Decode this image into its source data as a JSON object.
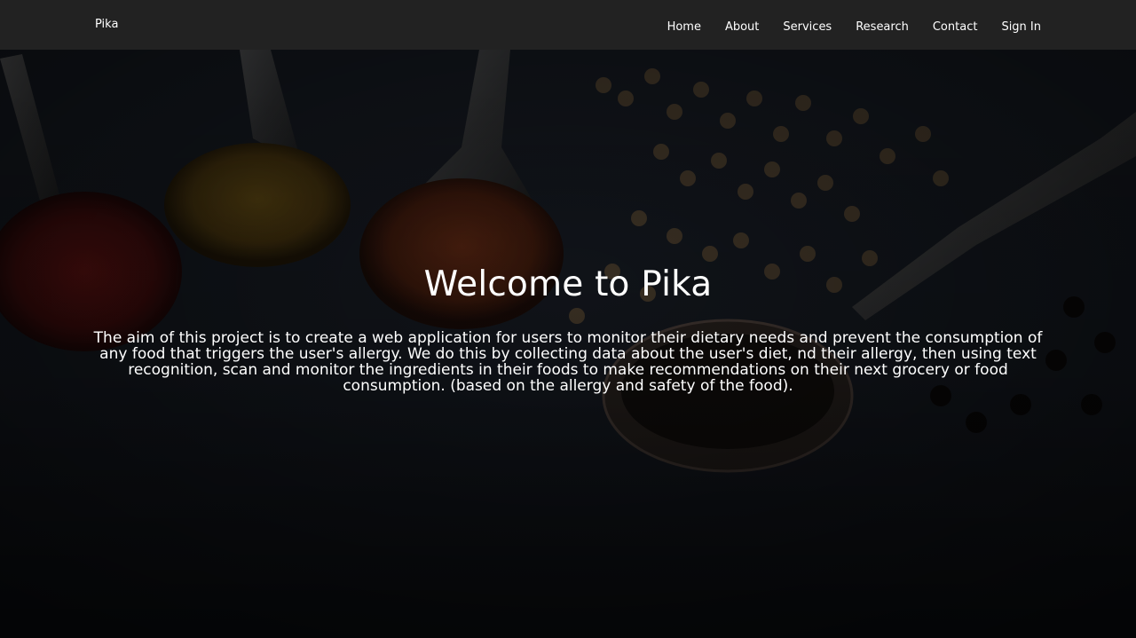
{
  "nav": {
    "brand": "Pika",
    "links": [
      "Home",
      "About",
      "Services",
      "Research",
      "Contact",
      "Sign In"
    ]
  },
  "hero": {
    "title": "Welcome to Pika",
    "description": "The aim of this project is to create a web application for users to monitor their dietary needs and prevent the consumption of any food that triggers the user's allergy. We do this by collecting data about the user's diet, nd their allergy, then using text recognition, scan and monitor the ingredients in their foods to make recommendations on their next grocery or food consumption. (based on the allergy and safety of the food).",
    "background_icon": "spices-photo"
  },
  "colors": {
    "navbar": "#222222",
    "text": "#ffffff",
    "background": "#1a1e25"
  }
}
